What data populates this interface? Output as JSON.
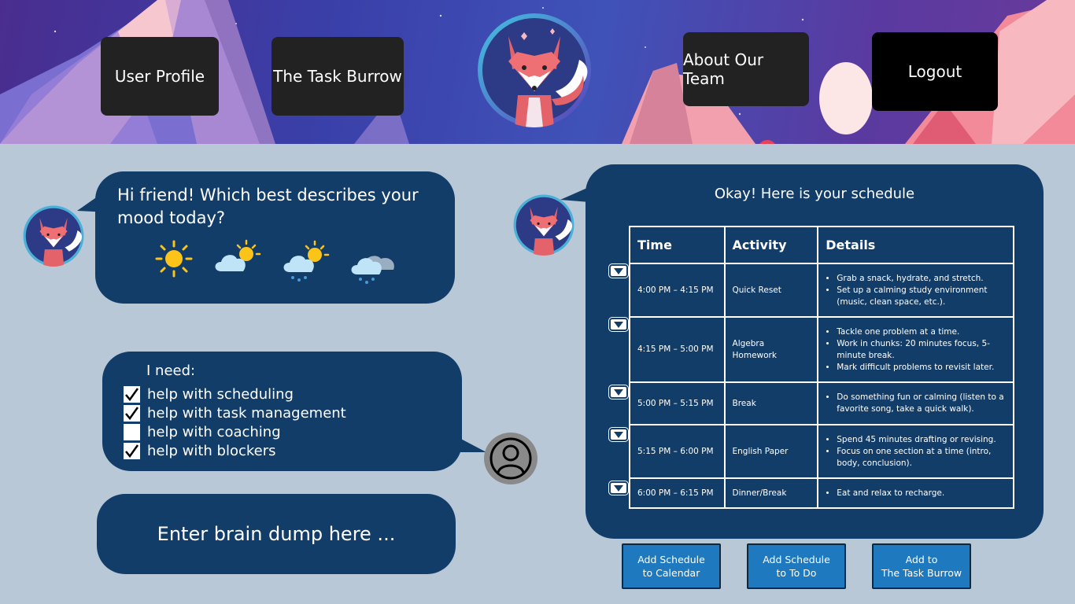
{
  "nav": {
    "user_profile": "User Profile",
    "task_burrow": "The Task Burrow",
    "about_team": "About Our Team",
    "logout": "Logout"
  },
  "mood": {
    "question": "Hi friend! Which best describes your mood today?",
    "options": [
      "sunny-icon",
      "partly-cloudy-icon",
      "sun-rain-icon",
      "rain-cloud-icon"
    ]
  },
  "needs": {
    "title": "I need:",
    "items": [
      {
        "label": "help with scheduling",
        "checked": true
      },
      {
        "label": "help with task management",
        "checked": true
      },
      {
        "label": "help with coaching",
        "checked": false
      },
      {
        "label": "help with blockers",
        "checked": true
      }
    ]
  },
  "brain_dump": {
    "placeholder": "Enter brain dump here ..."
  },
  "schedule": {
    "title": "Okay! Here is your schedule",
    "headers": [
      "Time",
      "Activity",
      "Details"
    ],
    "rows": [
      {
        "time": "4:00 PM – 4:15 PM",
        "activity": "Quick Reset",
        "details": [
          "Grab a snack, hydrate, and stretch.",
          "Set up a calming study environment (music, clean space, etc.)."
        ]
      },
      {
        "time": "4:15 PM – 5:00 PM",
        "activity": "Algebra Homework",
        "details": [
          "Tackle one problem at a time.",
          "Work in chunks: 20 minutes focus, 5-minute break.",
          "Mark difficult problems to revisit later."
        ]
      },
      {
        "time": "5:00 PM – 5:15 PM",
        "activity": "Break",
        "details": [
          "Do something fun or calming (listen to a favorite song, take a quick walk)."
        ]
      },
      {
        "time": "5:15 PM – 6:00 PM",
        "activity": "English Paper",
        "details": [
          " Spend 45 minutes drafting or revising.",
          "Focus on one section at a time (intro, body, conclusion)."
        ]
      },
      {
        "time": "6:00 PM – 6:15 PM",
        "activity": "Dinner/Break",
        "details": [
          "Eat and relax to recharge."
        ]
      }
    ]
  },
  "actions": {
    "calendar": [
      "Add Schedule",
      "to Calendar"
    ],
    "todo": [
      "Add Schedule",
      "to To Do"
    ],
    "burrow": [
      "Add to",
      "The Task Burrow"
    ]
  },
  "colors": {
    "page_bg": "#b8c8d6",
    "bubble": "#133d69",
    "button_blue": "#1f79bf",
    "nav_button": "#222222"
  }
}
